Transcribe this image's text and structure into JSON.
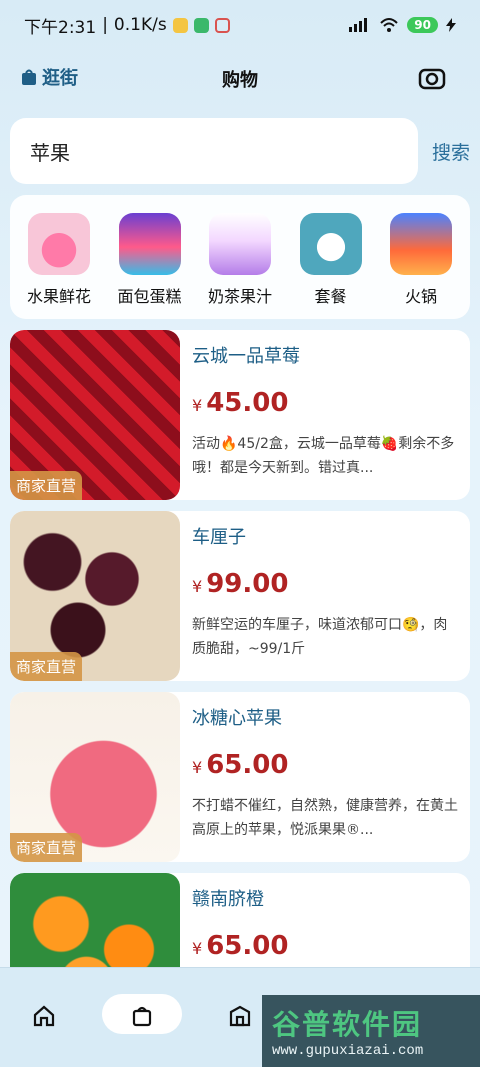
{
  "status": {
    "time": "下午2:31",
    "speed": "0.1K/s",
    "battery": "90"
  },
  "header": {
    "left_label": "逛街",
    "title": "购物"
  },
  "search": {
    "value": "苹果",
    "button": "搜索"
  },
  "categories": [
    {
      "label": "水果鲜花",
      "icon": "apple-icon"
    },
    {
      "label": "面包蛋糕",
      "icon": "cake-icon"
    },
    {
      "label": "奶茶果汁",
      "icon": "milk-tea-icon"
    },
    {
      "label": "套餐",
      "icon": "meal-set-icon"
    },
    {
      "label": "火锅",
      "icon": "hotpot-icon"
    }
  ],
  "products": [
    {
      "title": "云城一品草莓",
      "price": "45.00",
      "desc": "活动🔥45/2盒，云城一品草莓🍓剩余不多哦！都是今天新到。错过真...",
      "badge": "商家直营"
    },
    {
      "title": "车厘子",
      "price": "99.00",
      "desc": "新鲜空运的车厘子，味道浓郁可口🧐，肉质脆甜，~99/1斤",
      "badge": "商家直营"
    },
    {
      "title": "冰糖心苹果",
      "price": "65.00",
      "desc": "不打蜡不催红，自然熟，健康营养，在黄土高原上的苹果，悦派果果®...",
      "badge": "商家直营"
    },
    {
      "title": "赣南脐橙",
      "price": "65.00",
      "desc": "",
      "badge": ""
    }
  ],
  "currency": "¥",
  "watermark": {
    "title": "谷普软件园",
    "url": "www.gupuxiazai.com"
  }
}
